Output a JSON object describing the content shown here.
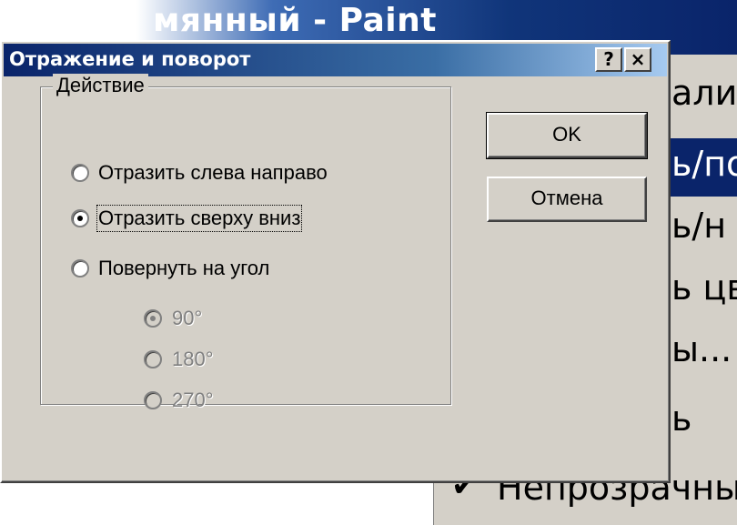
{
  "background_window": {
    "title_fragment": "мянный - Paint",
    "menu_items": [
      {
        "text": "али",
        "highlighted": false
      },
      {
        "text": "ь/по",
        "highlighted": true
      },
      {
        "text": "ь/н",
        "highlighted": false
      },
      {
        "text": "ь цв",
        "highlighted": false
      },
      {
        "text": "ы...",
        "highlighted": false
      },
      {
        "text": "ь",
        "highlighted": false
      },
      {
        "text": "Непрозрачны",
        "highlighted": false,
        "checked": true
      }
    ]
  },
  "dialog": {
    "title": "Отражение и поворот",
    "help_button": "?",
    "close_button": "×",
    "group_label": "Действие",
    "options": [
      {
        "label": "Отразить слева направо",
        "selected": false
      },
      {
        "label": "Отразить сверху вниз",
        "selected": true,
        "focused": true
      },
      {
        "label": "Повернуть на угол",
        "selected": false
      }
    ],
    "angle_options": [
      {
        "label": "90°",
        "selected": true,
        "disabled": true
      },
      {
        "label": "180°",
        "selected": false,
        "disabled": true
      },
      {
        "label": "270°",
        "selected": false,
        "disabled": true
      }
    ],
    "ok_button": "OK",
    "cancel_button": "Отмена"
  },
  "colors": {
    "title_bar_active": "#0a246a",
    "face": "#d4d0c8",
    "highlight": "#0a246a"
  }
}
